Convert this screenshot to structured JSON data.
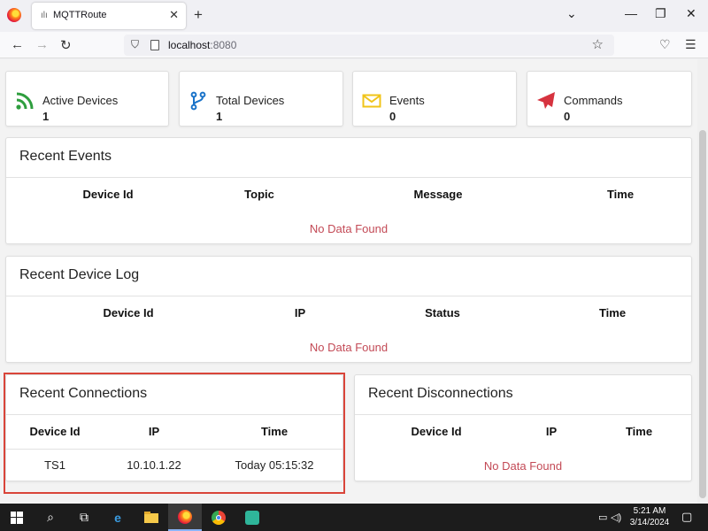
{
  "browser": {
    "tab_title": "MQTTRoute",
    "new_tab_symbol": "+",
    "url_host": "localhost",
    "url_port": ":8080"
  },
  "stats": [
    {
      "label": "Active Devices",
      "value": "1",
      "icon": "rss-icon",
      "color": "#2e9e3e"
    },
    {
      "label": "Total Devices",
      "value": "1",
      "icon": "branch-icon",
      "color": "#1a73c9"
    },
    {
      "label": "Events",
      "value": "0",
      "icon": "envelope-icon",
      "color": "#f0c419"
    },
    {
      "label": "Commands",
      "value": "0",
      "icon": "paper-plane-icon",
      "color": "#d6333f"
    }
  ],
  "recent_events": {
    "title": "Recent Events",
    "columns": [
      "Device Id",
      "Topic",
      "Message",
      "Time"
    ],
    "empty_text": "No Data Found"
  },
  "recent_device_log": {
    "title": "Recent Device Log",
    "columns": [
      "Device Id",
      "IP",
      "Status",
      "Time"
    ],
    "empty_text": "No Data Found"
  },
  "recent_connections": {
    "title": "Recent Connections",
    "columns": [
      "Device Id",
      "IP",
      "Time"
    ],
    "rows": [
      {
        "device_id": "TS1",
        "ip": "10.10.1.22",
        "time": "Today 05:15:32"
      }
    ]
  },
  "recent_disconnections": {
    "title": "Recent Disconnections",
    "columns": [
      "Device Id",
      "IP",
      "Time"
    ],
    "empty_text": "No Data Found"
  },
  "taskbar": {
    "time": "5:21 AM",
    "date": "3/14/2024"
  },
  "colors": {
    "empty_text": "#c34a56",
    "highlight_border": "#d9453a"
  }
}
